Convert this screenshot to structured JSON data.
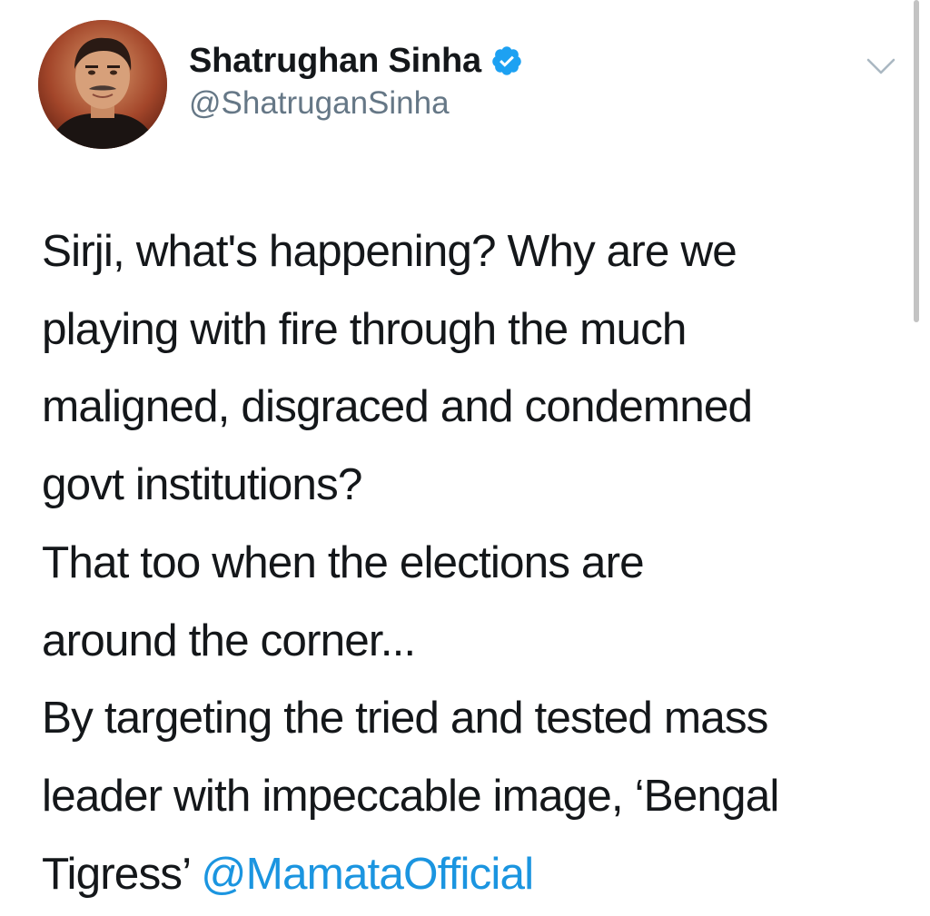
{
  "author": {
    "display_name": "Shatrughan Sinha",
    "handle": "@ShatruganSinha",
    "verified": true,
    "verified_icon": "verified-badge-icon",
    "avatar_icon": "avatar-photo"
  },
  "menu": {
    "icon": "chevron-down-icon"
  },
  "tweet": {
    "lines": [
      "Sirji, what's happening? Why are we",
      "playing with fire through the much",
      "maligned, disgraced and condemned",
      "govt institutions?",
      "That too when the elections are",
      "around the corner...",
      "By targeting the tried and tested mass",
      "leader with impeccable image, ‘Bengal",
      "Tigress’ "
    ],
    "mention": "@MamataOfficial"
  },
  "colors": {
    "text": "#14171a",
    "secondary": "#657786",
    "link": "#1b95e0",
    "verified": "#1da1f2",
    "chevron": "#aab8c2"
  }
}
